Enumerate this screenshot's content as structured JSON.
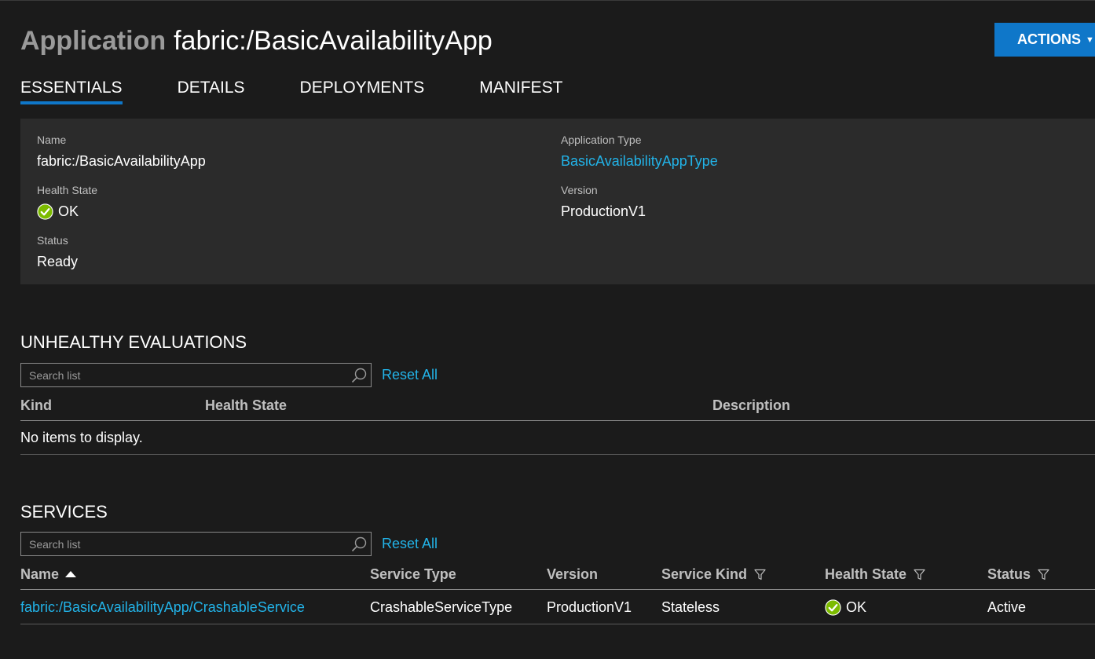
{
  "header": {
    "kind": "Application",
    "name": "fabric:/BasicAvailabilityApp",
    "actions_label": "ACTIONS"
  },
  "tabs": [
    {
      "label": "ESSENTIALS",
      "active": true
    },
    {
      "label": "DETAILS",
      "active": false
    },
    {
      "label": "DEPLOYMENTS",
      "active": false
    },
    {
      "label": "MANIFEST",
      "active": false
    }
  ],
  "essentials": {
    "name_label": "Name",
    "name_value": "fabric:/BasicAvailabilityApp",
    "health_label": "Health State",
    "health_value": "OK",
    "status_label": "Status",
    "status_value": "Ready",
    "app_type_label": "Application Type",
    "app_type_value": "BasicAvailabilityAppType",
    "version_label": "Version",
    "version_value": "ProductionV1"
  },
  "unhealthy": {
    "title": "UNHEALTHY EVALUATIONS",
    "search_placeholder": "Search list",
    "reset_label": "Reset All",
    "columns": [
      "Kind",
      "Health State",
      "Description"
    ],
    "empty_text": "No items to display."
  },
  "services": {
    "title": "SERVICES",
    "search_placeholder": "Search list",
    "reset_label": "Reset All",
    "columns": [
      "Name",
      "Service Type",
      "Version",
      "Service Kind",
      "Health State",
      "Status"
    ],
    "rows": [
      {
        "name": "fabric:/BasicAvailabilityApp/CrashableService",
        "service_type": "CrashableServiceType",
        "version": "ProductionV1",
        "service_kind": "Stateless",
        "health_state": "OK",
        "status": "Active"
      }
    ]
  },
  "colors": {
    "accent": "#0f77c9",
    "link": "#22b3e8",
    "ok_green": "#7cbb00",
    "background": "#1b1b1b",
    "panel": "#2b2b2b"
  },
  "icons": {
    "ok": "ok-check-icon",
    "search": "search-icon",
    "filter": "filter-icon",
    "sort": "sort-ascending-icon",
    "caret": "chevron-down-icon"
  }
}
